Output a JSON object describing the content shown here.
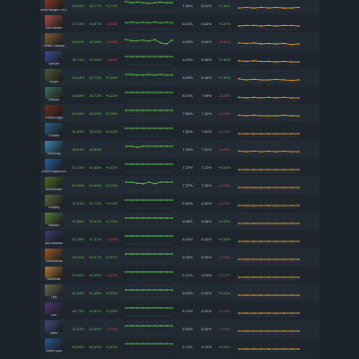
{
  "colors": {
    "positive": "#6bbf59",
    "negative": "#d9534f",
    "spark_green": "#5fb84a",
    "spark_orange": "#e0952b"
  },
  "rows": [
    {
      "hero": "Drow Ranger / Pit Lord",
      "c1": "48.06%",
      "c2": "48.77%",
      "c3": "+0.71%",
      "c3c": "green",
      "c5": "7.86%",
      "c6": "8.01%",
      "c7": "+1.45%",
      "c7c": "green",
      "left": [
        52,
        50,
        51,
        50,
        49,
        50,
        51,
        50,
        50
      ],
      "right": [
        40,
        41,
        40,
        41,
        40,
        41,
        40,
        40,
        41
      ],
      "portrait": "#8b3a2a"
    },
    {
      "hero": "Void Weaver",
      "c1": "47.22%",
      "c2": "48.07%",
      "c3": "-0.21%",
      "c3c": "red",
      "c5": "6.02%",
      "c6": "6.52%",
      "c7": "+0.27%",
      "c7c": "green",
      "left": [
        46,
        47,
        46,
        47,
        46,
        47,
        46,
        47,
        46
      ],
      "right": [
        40,
        41,
        41,
        40,
        41,
        40,
        41,
        41,
        40
      ],
      "portrait": "#a0524a"
    },
    {
      "hero": "Treant Protector",
      "c1": "39.60%",
      "c2": "40.06%",
      "c3": "-0.24%",
      "c3c": "red",
      "c5": "6.00%",
      "c6": "6.04%",
      "c7": "-0.94%",
      "c7c": "red",
      "left": [
        48,
        46,
        46,
        47,
        45,
        48,
        42,
        40,
        47
      ],
      "right": [
        42,
        41,
        42,
        40,
        41,
        40,
        41,
        39,
        40
      ],
      "portrait": "#7d5e3b"
    },
    {
      "hero": "Spectre",
      "c1": "52.11%",
      "c2": "52.09%",
      "c3": "-0.02%",
      "c3c": "red",
      "c5": "6.20%",
      "c6": "6.55%",
      "c7": "+0.35%",
      "c7c": "green",
      "left": [
        50,
        50,
        50,
        50,
        50,
        50,
        50,
        50,
        50
      ],
      "right": [
        42,
        41,
        42,
        41,
        41,
        40,
        41,
        40,
        40
      ],
      "portrait": "#3a4d8f"
    },
    {
      "hero": "Sniper",
      "c1": "52.44%",
      "c2": "52.72%",
      "c3": "+0.28%",
      "c3c": "green",
      "c5": "6.09%",
      "c6": "6.48%",
      "c7": "+0.39%",
      "c7c": "green",
      "left": [
        50,
        50,
        49,
        49,
        50,
        49,
        50,
        49,
        49
      ],
      "right": [
        42,
        40,
        41,
        40,
        40,
        41,
        40,
        39,
        40
      ],
      "portrait": "#4e5a3a"
    },
    {
      "hero": "Medusa",
      "c1": "49.68%",
      "c2": "49.72%",
      "c3": "+0.21%",
      "c3c": "green",
      "c5": "8.19%",
      "c6": "7.99%",
      "c7": "-0.20%",
      "c7c": "red",
      "left": [
        50,
        50,
        50,
        50,
        50,
        50,
        50,
        50,
        50
      ],
      "right": [
        41,
        40,
        41,
        40,
        41,
        40,
        41,
        40,
        40
      ],
      "portrait": "#3d6e5c"
    },
    {
      "hero": "Chaos Knight",
      "c1": "52.93%",
      "c2": "53.19%",
      "c3": "+0.26%",
      "c3c": "green",
      "c5": "7.56%",
      "c6": "7.42%",
      "c7": "-0.14%",
      "c7c": "red",
      "left": [
        50,
        50,
        50,
        50,
        50,
        50,
        50,
        50,
        50
      ],
      "right": [
        41,
        40,
        41,
        40,
        40,
        40,
        41,
        40,
        40
      ],
      "portrait": "#6b2c23"
    },
    {
      "hero": "Kunkka",
      "c1": "51.89%",
      "c2": "52.11%",
      "c3": "+0.22%",
      "c3c": "green",
      "c5": "7.82%",
      "c6": "7.61%",
      "c7": "-0.21%",
      "c7c": "red",
      "left": [
        50,
        50,
        50,
        50,
        50,
        50,
        50,
        50,
        50
      ],
      "right": [
        40,
        40,
        40,
        40,
        40,
        40,
        40,
        40,
        40
      ],
      "portrait": "#2f5e87"
    },
    {
      "hero": "Morphling",
      "c1": "48.67%",
      "c2": "48.80%",
      "c3": "",
      "c3c": "gray",
      "c5": "7.40%",
      "c6": "7.31%",
      "c7": "-0.09%",
      "c7c": "red",
      "left": [
        50,
        50,
        48,
        50,
        50,
        50,
        50,
        50,
        50
      ],
      "right": [
        41,
        40,
        41,
        40,
        41,
        40,
        41,
        40,
        40
      ],
      "portrait": "#3b8ab3"
    },
    {
      "hero": "Ancient Apparition",
      "c1": "51.43%",
      "c2": "51.65%",
      "c3": "+0.22%",
      "c3c": "green",
      "c5": "7.22%",
      "c6": "7.22%",
      "c7": "+0.00%",
      "c7c": "green",
      "left": [
        50,
        50,
        50,
        50,
        50,
        50,
        50,
        50,
        50
      ],
      "right": [
        40,
        40,
        40,
        40,
        40,
        40,
        40,
        40,
        40
      ],
      "portrait": "#2a5e9e"
    },
    {
      "hero": "Venomancer",
      "c1": "50.49%",
      "c2": "50.64%",
      "c3": "+0.15%",
      "c3c": "green",
      "c5": "7.22%",
      "c6": "7.00%",
      "c7": "-0.22%",
      "c7c": "red",
      "left": [
        50,
        50,
        48,
        47,
        50,
        47,
        50,
        50,
        50
      ],
      "right": [
        40,
        40,
        40,
        40,
        40,
        40,
        40,
        40,
        40
      ],
      "portrait": "#4d6b2a"
    },
    {
      "hero": "Undying",
      "c1": "51.61%",
      "c2": "51.72%",
      "c3": "+0.11%",
      "c3c": "green",
      "c5": "6.69%",
      "c6": "6.62%",
      "c7": "-0.07%",
      "c7c": "red",
      "left": [
        50,
        50,
        50,
        50,
        50,
        50,
        50,
        50,
        50
      ],
      "right": [
        40,
        40,
        40,
        40,
        40,
        40,
        40,
        40,
        40
      ],
      "portrait": "#5d6b3d"
    },
    {
      "hero": "Warlock",
      "c1": "51.88%",
      "c2": "52.61%",
      "c3": "+0.74%",
      "c3c": "green",
      "c5": "6.08%",
      "c6": "6.08%",
      "c7": "+0.00%",
      "c7c": "green",
      "left": [
        50,
        50,
        50,
        50,
        50,
        50,
        50,
        50,
        50
      ],
      "right": [
        40,
        40,
        40,
        40,
        40,
        40,
        40,
        40,
        40
      ],
      "portrait": "#5a7a3c"
    },
    {
      "hero": "Nyx Assassin",
      "c1": "51.35%",
      "c2": "51.31%",
      "c3": "-0.04%",
      "c3c": "red",
      "c5": "6.00%",
      "c6": "6.30%",
      "c7": "+0.30%",
      "c7c": "green",
      "left": [
        50,
        50,
        50,
        50,
        50,
        50,
        50,
        50,
        50
      ],
      "right": [
        40,
        40,
        40,
        40,
        40,
        40,
        40,
        40,
        40
      ],
      "portrait": "#3a3a6b"
    },
    {
      "hero": "Enchantress",
      "c1": "50.20%",
      "c2": "50.57%",
      "c3": "+0.37%",
      "c3c": "green",
      "c5": "6.35%",
      "c6": "6.09%",
      "c7": "-0.26%",
      "c7c": "red",
      "left": [
        50,
        50,
        50,
        50,
        50,
        50,
        50,
        50,
        50
      ],
      "right": [
        40,
        40,
        40,
        40,
        40,
        40,
        40,
        40,
        40
      ],
      "portrait": "#9e5a2a"
    },
    {
      "hero": "Alchemist",
      "c1": "49.46%",
      "c2": "49.35%",
      "c3": "-0.11%",
      "c3c": "red",
      "c5": "6.21%",
      "c6": "6.04%",
      "c7": "-0.17%",
      "c7c": "red",
      "left": [
        50,
        50,
        50,
        50,
        50,
        50,
        50,
        50,
        50
      ],
      "right": [
        40,
        40,
        40,
        40,
        40,
        40,
        40,
        40,
        40
      ],
      "portrait": "#a87a3a"
    },
    {
      "hero": "Tiny",
      "c1": "51.68%",
      "c2": "51.68%",
      "c3": "+0.00%",
      "c3c": "green",
      "c5": "6.00%",
      "c6": "6.00%",
      "c7": "+0.00%",
      "c7c": "green",
      "left": [
        50,
        50,
        50,
        50,
        50,
        50,
        50,
        50,
        50
      ],
      "right": [
        40,
        40,
        40,
        40,
        40,
        40,
        40,
        40,
        40
      ],
      "portrait": "#6b6b5a"
    },
    {
      "hero": "Lion",
      "c1": "48.73%",
      "c2": "48.82%",
      "c3": "+0.09%",
      "c3c": "green",
      "c5": "6.79%",
      "c6": "6.64%",
      "c7": "-0.15%",
      "c7c": "red",
      "left": [
        50,
        50,
        50,
        50,
        50,
        50,
        50,
        50,
        50
      ],
      "right": [
        40,
        40,
        40,
        40,
        40,
        40,
        40,
        40,
        40
      ],
      "portrait": "#4a3a6e"
    },
    {
      "hero": "Bane",
      "c1": "50.81%",
      "c2": "50.69%",
      "c3": "-0.12%",
      "c3c": "red",
      "c5": "6.95%",
      "c6": "6.83%",
      "c7": "-0.12%",
      "c7c": "red",
      "left": [
        50,
        50,
        50,
        50,
        50,
        50,
        50,
        50,
        50
      ],
      "right": [
        40,
        40,
        40,
        40,
        40,
        40,
        40,
        40,
        40
      ],
      "portrait": "#3e4a7a"
    },
    {
      "hero": "Storm Spirit",
      "c1": "52.69%",
      "c2": "53.60%",
      "c3": "+0.91%",
      "c3c": "green",
      "c5": "5.76%",
      "c6": "5.79%",
      "c7": "+0.03%",
      "c7c": "green",
      "left": [
        50,
        50,
        50,
        50,
        50,
        50,
        50,
        50,
        50
      ],
      "right": [
        40,
        40,
        40,
        40,
        40,
        40,
        40,
        40,
        40
      ],
      "portrait": "#2c5a8e"
    }
  ]
}
